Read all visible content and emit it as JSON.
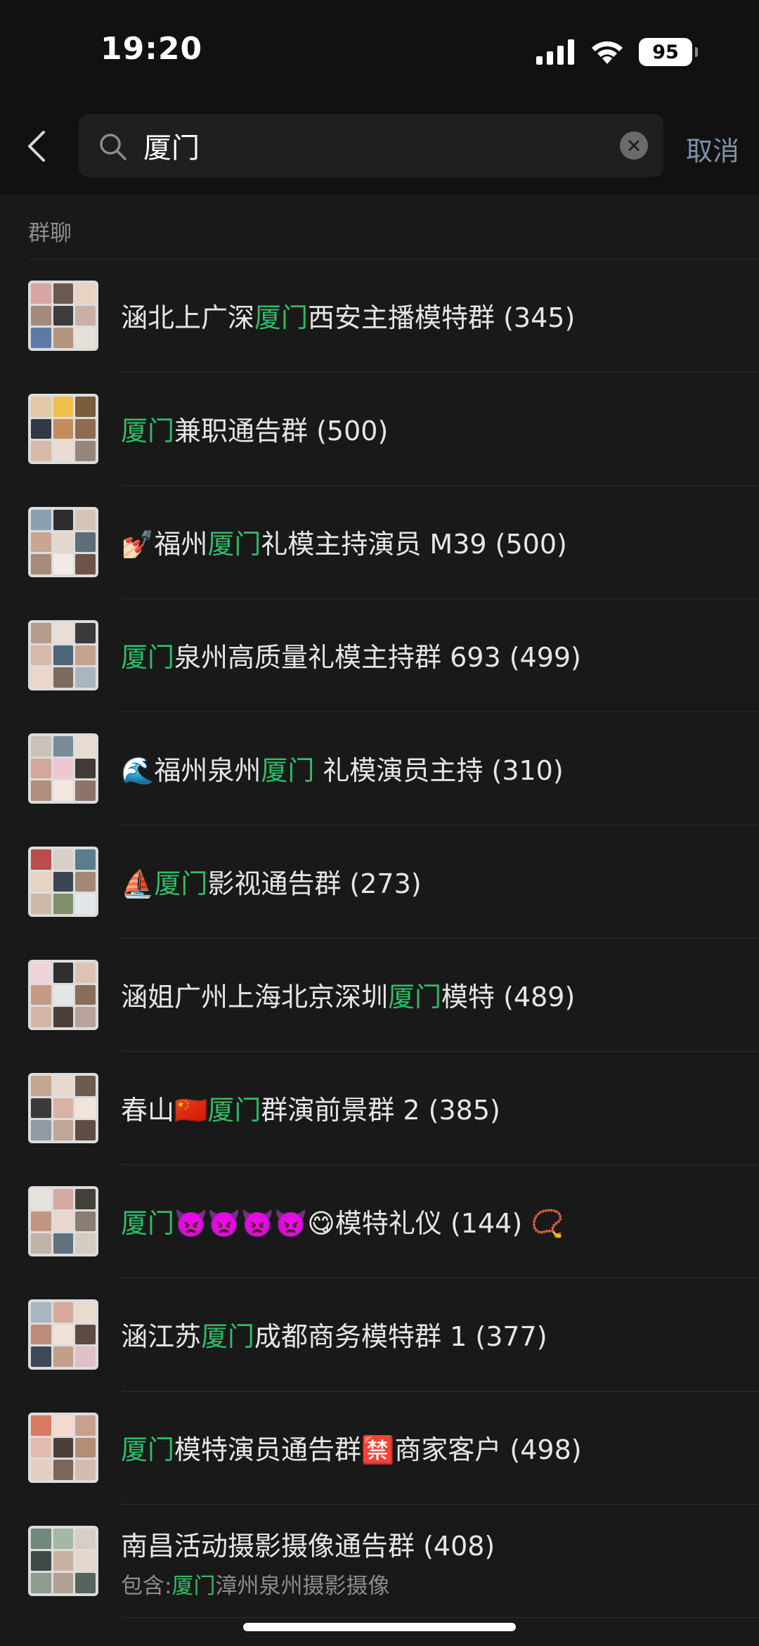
{
  "status_bar": {
    "time": "19:20",
    "battery": "95"
  },
  "search": {
    "query": "厦门",
    "cancel_label": "取消"
  },
  "section": {
    "label": "群聊"
  },
  "rows": [
    {
      "pre": "涵北上广深",
      "match": "厦门",
      "post": "西安主播模特群 (345)"
    },
    {
      "pre": "",
      "match": "厦门",
      "post": "兼职通告群 (500)"
    },
    {
      "pre": "💅🏻福州",
      "match": "厦门",
      "post": "礼模主持演员 M39 (500)"
    },
    {
      "pre": "",
      "match": "厦门",
      "post": "泉州高质量礼模主持群 693 (499)"
    },
    {
      "pre": "🌊福州泉州",
      "match": "厦门",
      "post": " 礼模演员主持 (310)"
    },
    {
      "pre": "⛵",
      "match": "厦门",
      "post": "影视通告群 (273)"
    },
    {
      "pre": "涵姐广州上海北京深圳",
      "match": "厦门",
      "post": "模特 (489)"
    },
    {
      "pre": "春山🇨🇳",
      "match": "厦门",
      "post": "群演前景群 2 (385)"
    },
    {
      "pre": "",
      "match": "厦门",
      "post": "👿👿👿👿😋模特礼仪 (144) 📿"
    },
    {
      "pre": "涵江苏",
      "match": "厦门",
      "post": "成都商务模特群 1 (377)"
    },
    {
      "pre": "",
      "match": "厦门",
      "post": "模特演员通告群🈲商家客户 (498)"
    },
    {
      "pre": "南昌活动摄影摄像通告群 (408)",
      "match": "",
      "post": "",
      "sub_pre": "包含:",
      "sub_match": "厦门",
      "sub_post": "漳州泉州摄影摄像"
    }
  ],
  "colors": {
    "highlight": "#2fbd67",
    "background": "#191919",
    "header": "#111111",
    "cancel": "#7d90a9"
  },
  "icons": [
    "chevron-left-icon",
    "search-icon",
    "clear-icon",
    "signal-icon",
    "wifi-icon",
    "battery-icon",
    "group-avatar-icon"
  ]
}
